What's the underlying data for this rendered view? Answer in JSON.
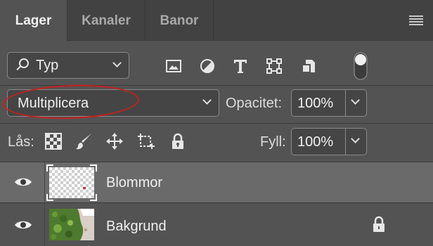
{
  "tabs": [
    {
      "label": "Lager",
      "active": true
    },
    {
      "label": "Kanaler",
      "active": false
    },
    {
      "label": "Banor",
      "active": false
    }
  ],
  "filter": {
    "kind_label": "Typ",
    "icons": [
      "image-filter-icon",
      "adjustment-filter-icon",
      "type-filter-icon",
      "shape-filter-icon",
      "smart-object-filter-icon",
      "filter-toggle-switch"
    ]
  },
  "blend": {
    "mode": "Multiplicera",
    "opacity_label": "Opacitet:",
    "opacity_value": "100%"
  },
  "lock": {
    "label": "Lås:",
    "fill_label": "Fyll:",
    "fill_value": "100%"
  },
  "layers": [
    {
      "name": "Blommor",
      "visible": true,
      "selected": true,
      "locked": false
    },
    {
      "name": "Bakgrund",
      "visible": true,
      "selected": false,
      "locked": true
    }
  ],
  "colors": {
    "panel_bg": "#535353",
    "tab_bar_bg": "#424242",
    "selected_layer_bg": "#6a6a6a",
    "highlight_ellipse": "#c8201c"
  }
}
